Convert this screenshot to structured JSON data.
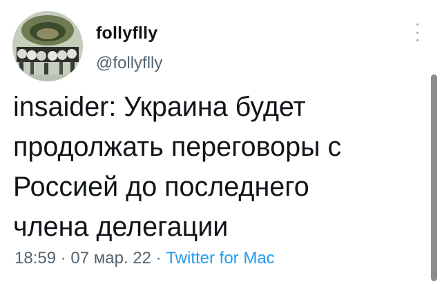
{
  "tweet": {
    "display_name": "follyflly",
    "handle": "@follyflly",
    "text": "insaider: Украина будет\nпродолжать переговоры с\nРоссией до последнего\nчлена делегации",
    "time": "18:59",
    "separator": " · ",
    "date": "07 мар. 22",
    "source": "Twitter for Mac"
  },
  "icons": {
    "more": "more-vertical-icon"
  },
  "colors": {
    "text_primary": "#0f1419",
    "text_secondary": "#536471",
    "link": "#1d9bf0",
    "scrollbar": "#8c8c8c"
  }
}
